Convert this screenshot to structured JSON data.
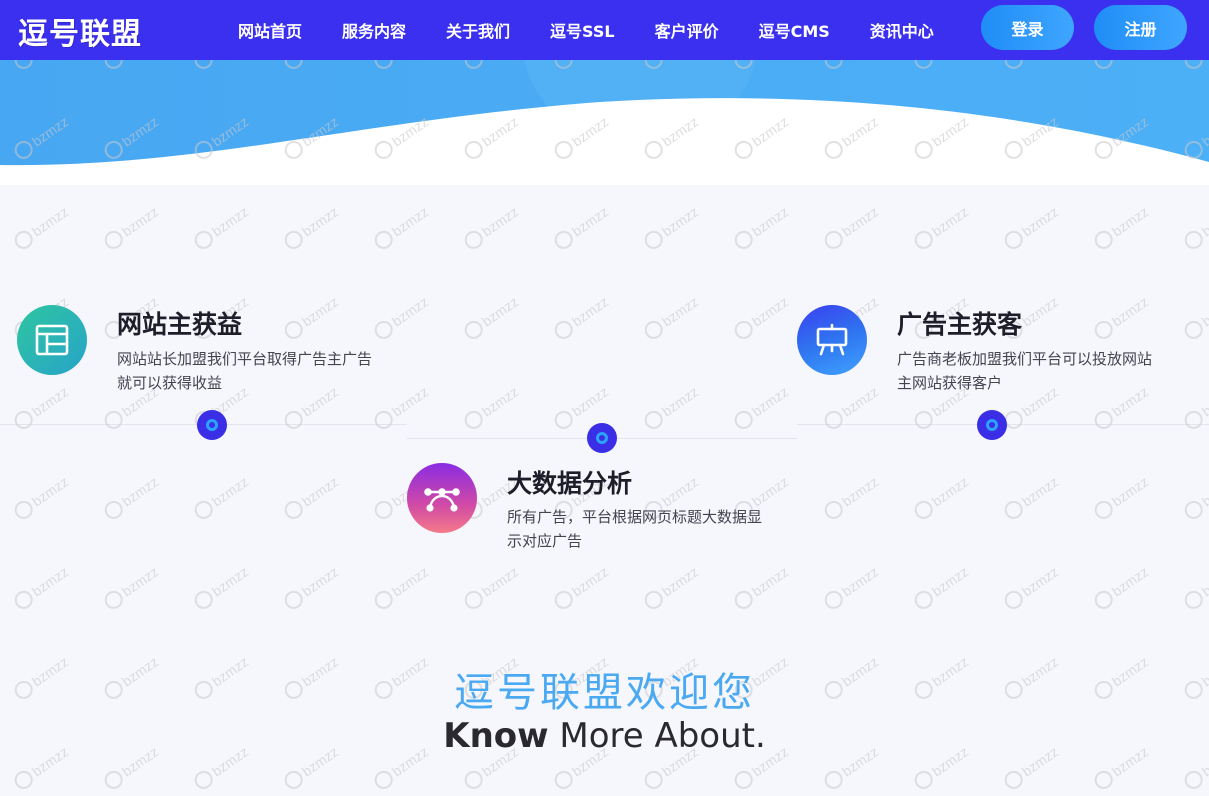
{
  "header": {
    "logo_text": "逗号联盟",
    "nav": [
      {
        "label": "网站首页"
      },
      {
        "label": "服务内容"
      },
      {
        "label": "关于我们"
      },
      {
        "label": "逗号SSL"
      },
      {
        "label": "客户评价"
      },
      {
        "label": "逗号CMS"
      },
      {
        "label": "资讯中心"
      }
    ],
    "login_label": "登录",
    "register_label": "注册"
  },
  "features": [
    {
      "title": "网站主获益",
      "desc": "网站站长加盟我们平台取得广告主广告就可以获得收益",
      "icon": "layout-icon"
    },
    {
      "title": "大数据分析",
      "desc": "所有广告，平台根据网页标题大数据显示对应广告",
      "icon": "bezier-curve-icon"
    },
    {
      "title": "广告主获客",
      "desc": "广告商老板加盟我们平台可以投放网站主网站获得客户",
      "icon": "presentation-board-icon"
    }
  ],
  "welcome": {
    "title": "逗号联盟欢迎您",
    "sub_bold": "Know",
    "sub_rest": " More About."
  },
  "watermark": "bzmzz",
  "colors": {
    "nav_bg": "#3b2ff0",
    "button_gradient_start": "#1f8df7",
    "button_gradient_end": "#3fa6ff",
    "hero_blue": "#48a9f3",
    "welcome_title": "#4aa9f0",
    "timeline_dot": "#3a2ee6"
  }
}
